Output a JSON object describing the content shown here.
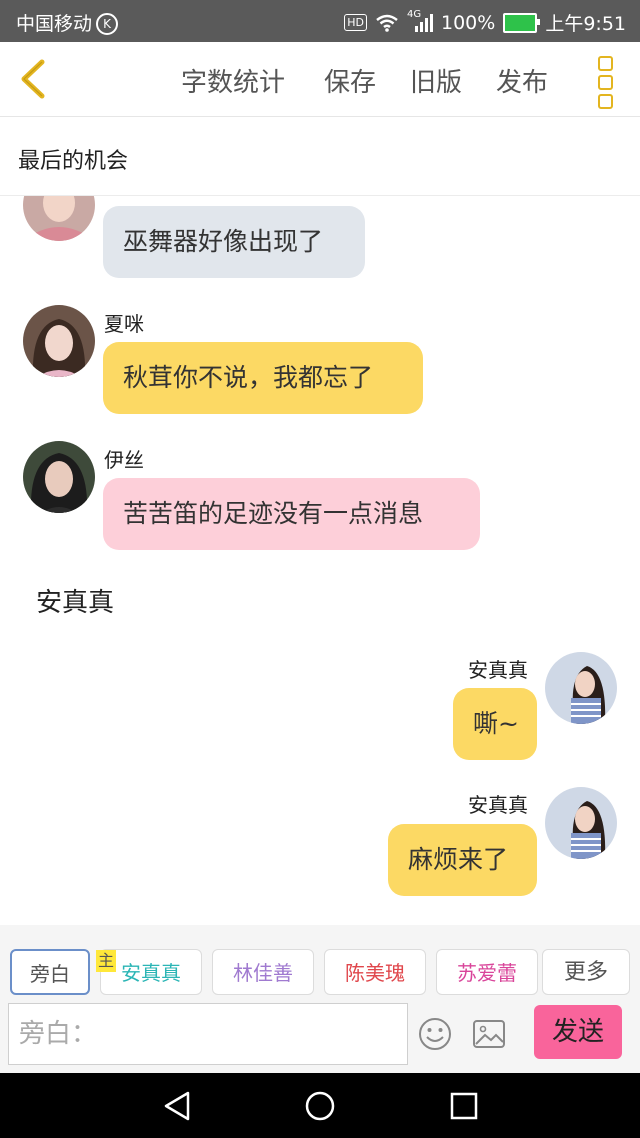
{
  "status_bar": {
    "carrier": "中国移动",
    "carrier_badge": "K",
    "hd": "HD",
    "network": "4G",
    "battery": "100%",
    "time": "上午9:51"
  },
  "toolbar": {
    "word_count": "字数统计",
    "save": "保存",
    "old_version": "旧版",
    "publish": "发布"
  },
  "story_title": "最后的机会",
  "messages": [
    {
      "speaker": "",
      "text": "巫舞器好像出现了",
      "color": "#e1e6ec"
    },
    {
      "speaker": "夏咪",
      "text": "秋茸你不说，我都忘了",
      "color": "#fcd964"
    },
    {
      "speaker": "伊丝",
      "text": "苦苦笛的足迹没有一点消息",
      "color": "#fdcfd9"
    },
    {
      "narration": "安真真"
    },
    {
      "speaker": "安真真",
      "text": "嘶~",
      "color": "#fcd964"
    },
    {
      "speaker": "安真真",
      "text": "麻烦来了",
      "color": "#fcd964"
    }
  ],
  "roles": {
    "host_badge": "主",
    "items": [
      {
        "label": "旁白",
        "color": "#555555"
      },
      {
        "label": "安真真",
        "color": "#2bb5b5"
      },
      {
        "label": "林佳善",
        "color": "#a07ad0"
      },
      {
        "label": "陈美瑰",
        "color": "#e0474c"
      },
      {
        "label": "苏爱蕾",
        "color": "#d9459a"
      },
      {
        "label": "更多",
        "color": "#555555"
      }
    ]
  },
  "composer": {
    "placeholder": "旁白：",
    "send": "发送"
  }
}
